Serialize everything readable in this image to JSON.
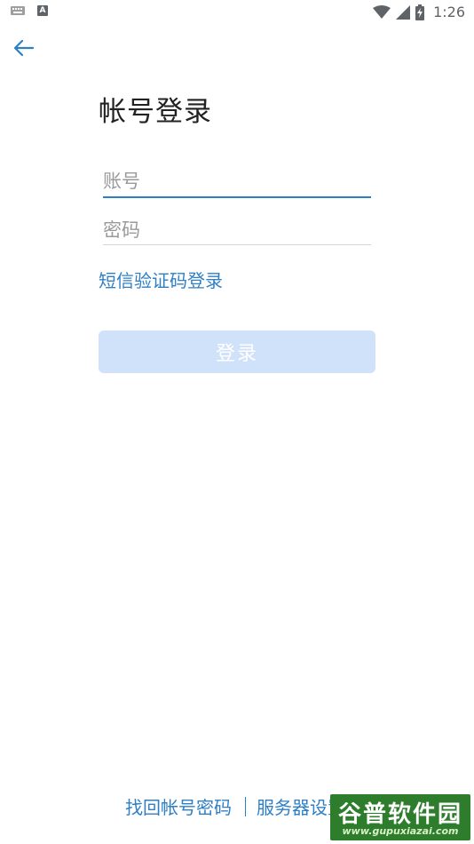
{
  "status_bar": {
    "time": "1:26",
    "icons": [
      "keyboard-icon",
      "text-a-icon",
      "wifi-icon",
      "cell-signal-icon",
      "battery-icon"
    ]
  },
  "header": {
    "back_icon": "arrow-left-icon",
    "title": "帐号登录"
  },
  "form": {
    "account_placeholder": "账号",
    "account_value": "",
    "password_placeholder": "密码",
    "password_value": "",
    "sms_login_link": "短信验证码登录",
    "login_button": "登录"
  },
  "footer": {
    "forgot_link": "找回帐号密码",
    "server_settings_link": "服务器设置"
  },
  "watermark": {
    "brand": "谷普软件园",
    "url": "www.gupuxiazai.com"
  },
  "colors": {
    "accent": "#2f7fc5",
    "button_disabled": "#cfe2f9",
    "title_text": "#222222",
    "watermark_bg": "#2e7d2c"
  }
}
